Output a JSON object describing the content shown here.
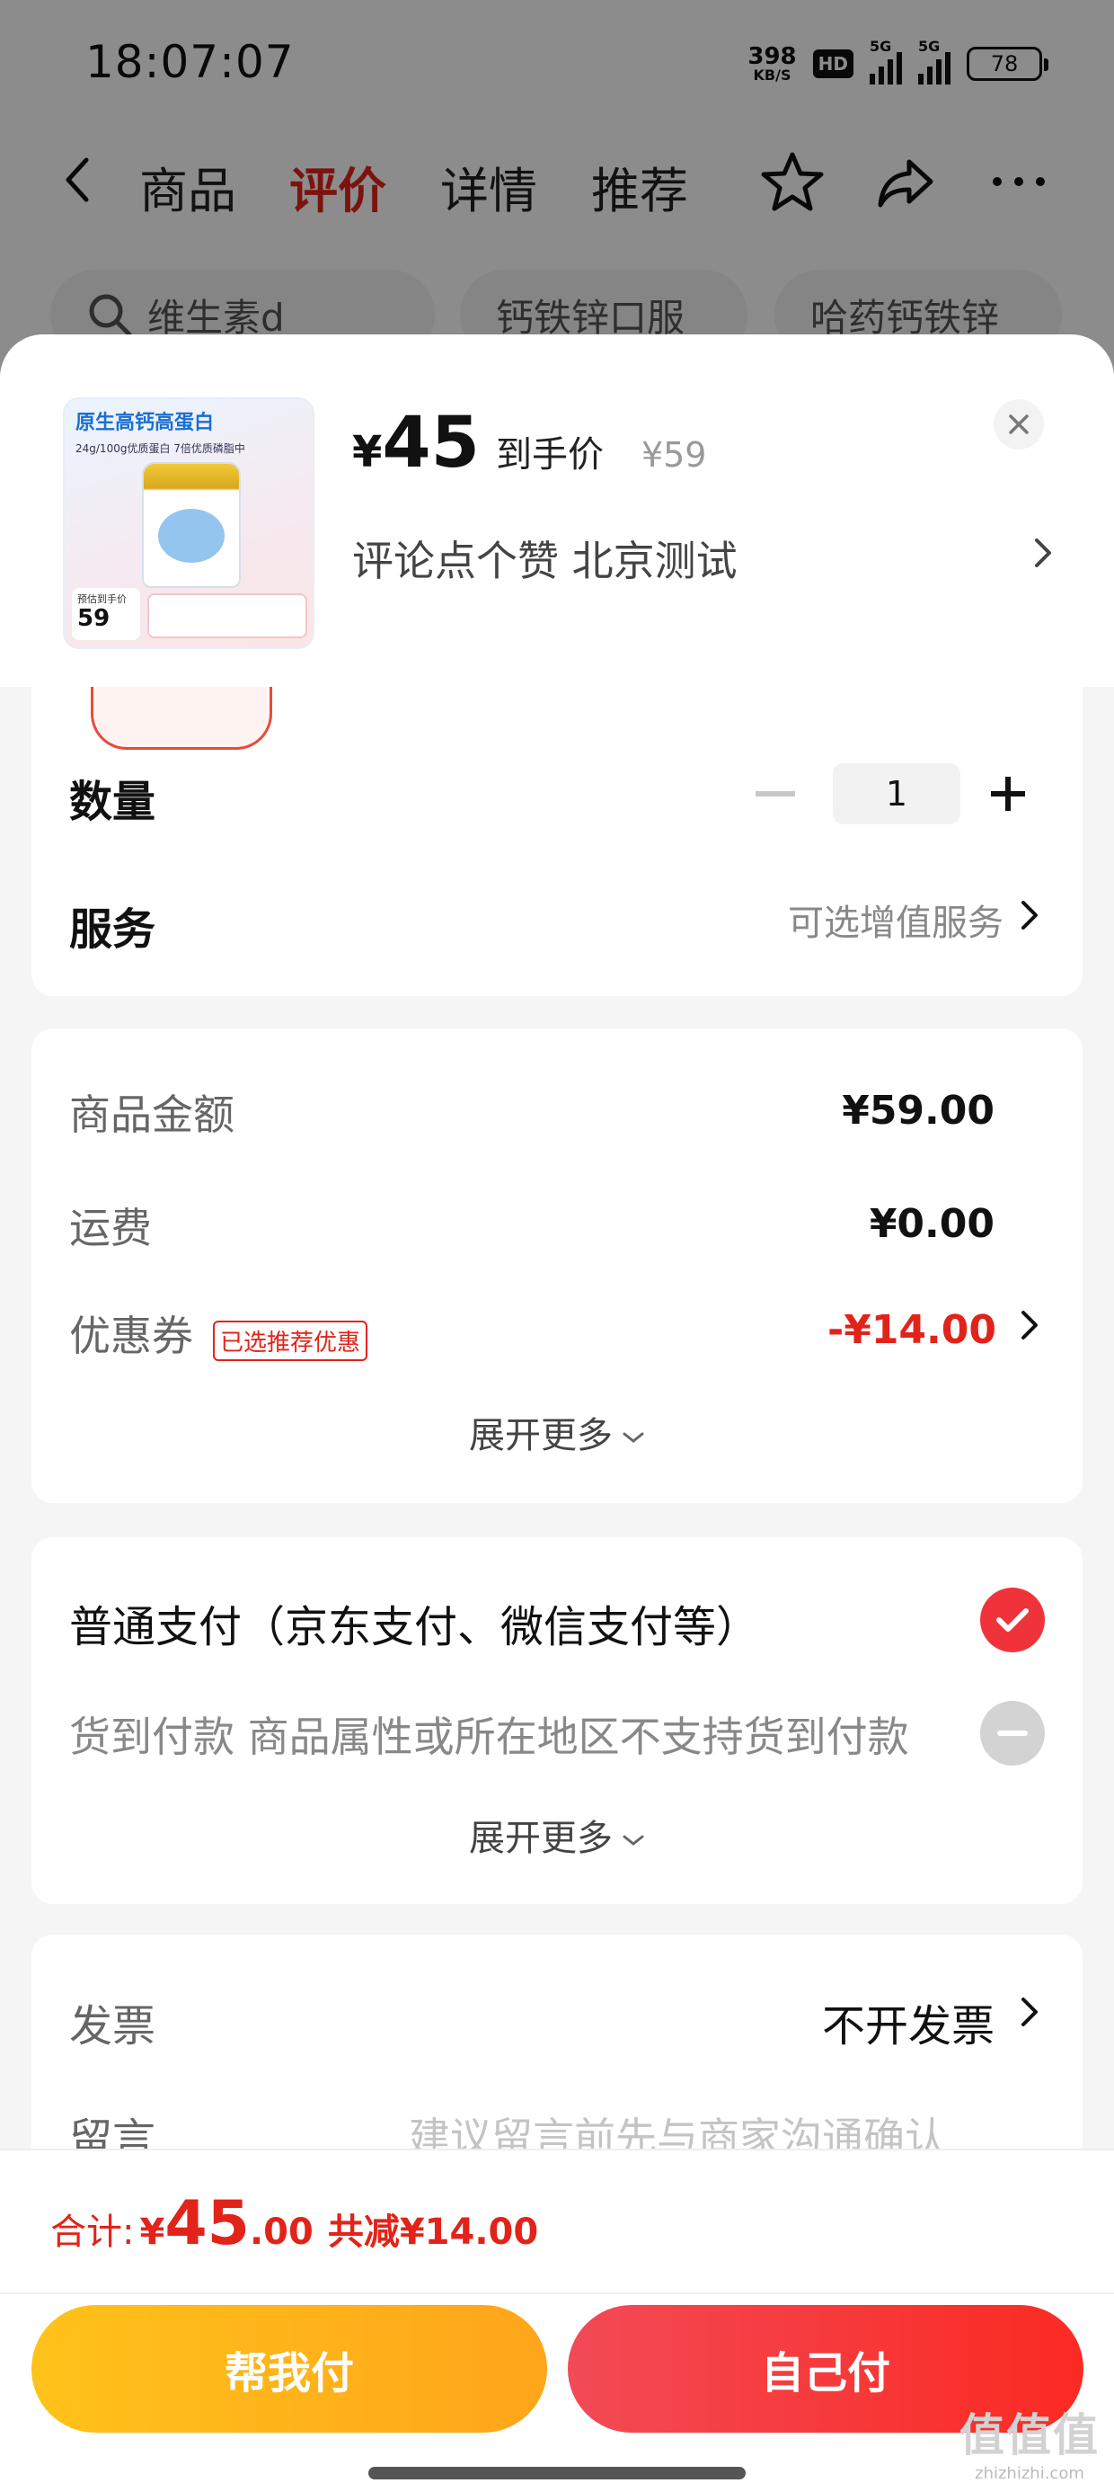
{
  "status_bar": {
    "time": "18:07:07",
    "net_speed_value": "398",
    "net_speed_unit": "KB/S",
    "hd_badge": "HD",
    "signal_1": "5G",
    "signal_2": "5G",
    "battery": "78"
  },
  "nav": {
    "tabs": [
      {
        "label": "商品"
      },
      {
        "label": "评价",
        "active": true
      },
      {
        "label": "详情"
      },
      {
        "label": "推荐"
      }
    ],
    "icons": [
      "back-arrow-icon",
      "star-icon",
      "share-icon",
      "more-icon"
    ]
  },
  "search_chips": [
    "维生素d",
    "钙铁锌口服",
    "哈药钙铁锌"
  ],
  "sheet": {
    "product": {
      "image_title": "原生高钙高蛋白",
      "image_subtitle": "24g/100g优质蛋白 7倍优质磷脂中",
      "image_price_label": "预估到手价",
      "image_price": "59",
      "price_symbol": "¥",
      "price": "45",
      "price_tag": "到手价",
      "original_price": "¥59",
      "subtitle": "评论点个赞  北京测试"
    },
    "quantity": {
      "label": "数量",
      "value": "1"
    },
    "service": {
      "label": "服务",
      "value": "可选增值服务"
    },
    "price_detail": {
      "goods_label": "商品金额",
      "goods_value": "¥59.00",
      "shipping_label": "运费",
      "shipping_value": "¥0.00",
      "coupon_label": "优惠券",
      "coupon_badge": "已选推荐优惠",
      "coupon_value": "-¥14.00",
      "expand_label": "展开更多"
    },
    "payment": {
      "normal_label": "普通支付（京东支付、微信支付等）",
      "normal_selected": true,
      "cod_label": "货到付款 商品属性或所在地区不支持货到付款",
      "cod_enabled": false,
      "expand_label": "展开更多"
    },
    "invoice": {
      "label": "发票",
      "value": "不开发票"
    },
    "message": {
      "label": "留言",
      "placeholder": "建议留言前先与商家沟通确认"
    }
  },
  "bottom_bar": {
    "total_label": "合计:",
    "total_yen": "¥",
    "total_int": "45",
    "total_dec": ".00",
    "saved_label": "共减¥14.00",
    "help_pay_button": "帮我付",
    "self_pay_button": "自己付"
  },
  "watermark": {
    "logo": "值值值",
    "site": "zhizhizhi.com"
  },
  "colors": {
    "accent_red": "#e2231a",
    "help_button": "#ffb31a",
    "self_button": "#f5383e",
    "sheet_bg": "#f5f5f5"
  }
}
